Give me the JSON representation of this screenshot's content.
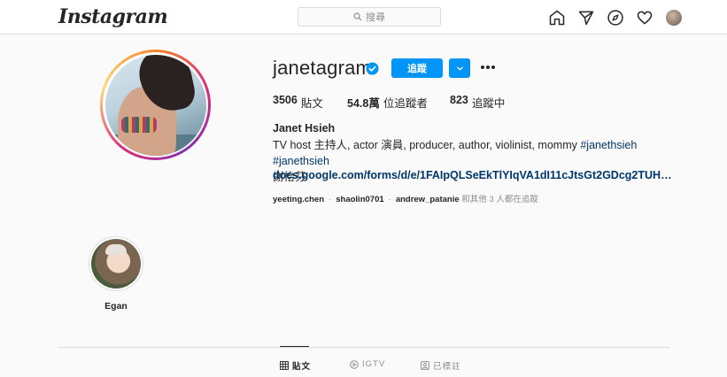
{
  "header": {
    "logo_text": "Instagram",
    "search_placeholder": "搜尋",
    "nav_icons": [
      "home-icon",
      "direct-icon",
      "explore-icon",
      "activity-heart-icon",
      "profile-avatar"
    ]
  },
  "profile": {
    "username": "janetagram",
    "verified": true,
    "follow_label": "追蹤",
    "stats": {
      "posts_count": "3506",
      "posts_label": "貼文",
      "followers_count": "54.8萬",
      "followers_label": "位追蹤者",
      "following_count": "823",
      "following_label": "追蹤中"
    },
    "full_name": "Janet Hsieh",
    "bio_text": "TV host 主持人, actor 演員, producer, author, violinist, mommy ",
    "bio_tag_1": "#janethsieh",
    "bio_tag_2": "#janethsieh",
    "bio_line2": "謝怡芬",
    "link": "docs.google.com/forms/d/e/1FAIpQLSeEkTlYIqVA1dI11cJtsGt2GDcg2TUHMXGM2lz...",
    "followed_by": {
      "user1": "yeeting.chen",
      "user2": "shaolin0701",
      "user3": "andrew_patanie",
      "suffix": "和其他 3 人都在追蹤"
    }
  },
  "highlights": [
    {
      "label": "Egan"
    }
  ],
  "tabs": [
    {
      "label": "貼文",
      "active": true
    },
    {
      "label": "IGTV",
      "active": false
    },
    {
      "label": "已標註",
      "active": false
    }
  ],
  "colors": {
    "accent_blue": "#0095f6",
    "link_blue": "#00376b",
    "muted_text": "#8e8e8e",
    "border": "#dbdbdb"
  }
}
